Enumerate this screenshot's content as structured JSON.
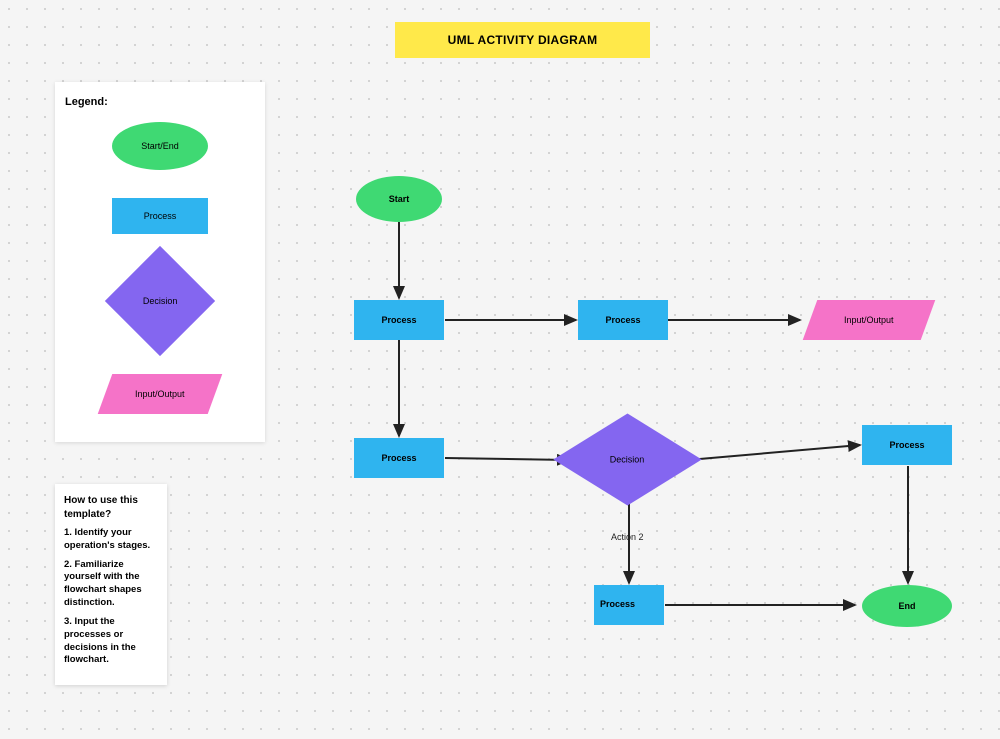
{
  "title": "UML ACTIVITY DIAGRAM",
  "legend": {
    "heading": "Legend:",
    "startend": "Start/End",
    "process": "Process",
    "decision": "Decision",
    "io": "Input/Output"
  },
  "howto": {
    "heading": "How to use this template?",
    "step1": "1. Identify your operation's stages.",
    "step2": "2. Familiarize yourself with the flowchart shapes distinction.",
    "step3": "3. Input the processes or decisions in the flowchart."
  },
  "nodes": {
    "start": "Start",
    "p1": "Process",
    "p2": "Process",
    "io1": "Input/Output",
    "p3": "Process",
    "decision": "Decision",
    "p4": "Process",
    "p5": "Process",
    "end": "End"
  },
  "edgeLabels": {
    "action2": "Action 2"
  }
}
